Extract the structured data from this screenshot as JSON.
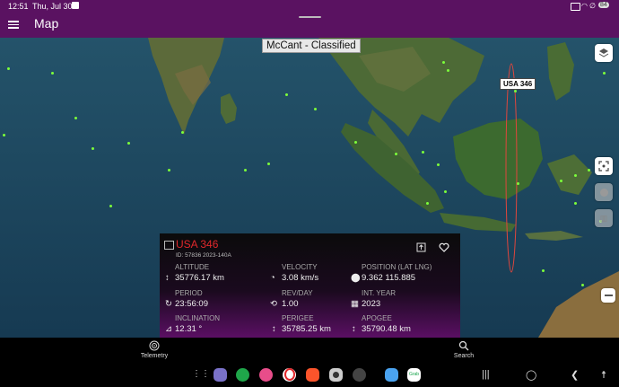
{
  "status": {
    "time": "12:51",
    "date": "Thu, Jul 30",
    "battery": "84"
  },
  "appbar": {
    "title": "Map"
  },
  "map": {
    "overlay_title": "McCant - Classified",
    "satellite_label": "USA 346"
  },
  "panel": {
    "name": "USA 346",
    "ids": "ID: 57836 2023-140A",
    "fields": [
      {
        "label": "ALTITUDE",
        "value": "35776.17 km",
        "icon": "altitude-icon"
      },
      {
        "label": "VELOCITY",
        "value": "3.08 km/s",
        "icon": "velocity-icon"
      },
      {
        "label": "POSITION (LAT LNG)",
        "value": "9.362 115.885",
        "icon": "location-pin-icon"
      },
      {
        "label": "PERIOD",
        "value": "23:56:09",
        "icon": "period-icon"
      },
      {
        "label": "REV/DAY",
        "value": "1.00",
        "icon": "revolutions-icon"
      },
      {
        "label": "INT. YEAR",
        "value": "2023",
        "icon": "calendar-icon"
      },
      {
        "label": "INCLINATION",
        "value": "12.31 °",
        "icon": "inclination-icon"
      },
      {
        "label": "PERIGEE",
        "value": "35785.25 km",
        "icon": "perigee-icon"
      },
      {
        "label": "APOGEE",
        "value": "35790.48 km",
        "icon": "apogee-icon"
      }
    ]
  },
  "bottom_nav": {
    "telemetry": "Telemetry",
    "search": "Search"
  },
  "dock": {
    "apps": [
      "Mail",
      "Phone",
      "Gallery",
      "Opera",
      "Brave",
      "Camera",
      "Settings",
      "Store",
      "Grab"
    ],
    "grab_label": "Grab"
  },
  "colors": {
    "appbar": "#5a1261",
    "satellite_dot": "#7cff3a",
    "orbit": "#e0463d",
    "name_red": "#e0282b"
  }
}
